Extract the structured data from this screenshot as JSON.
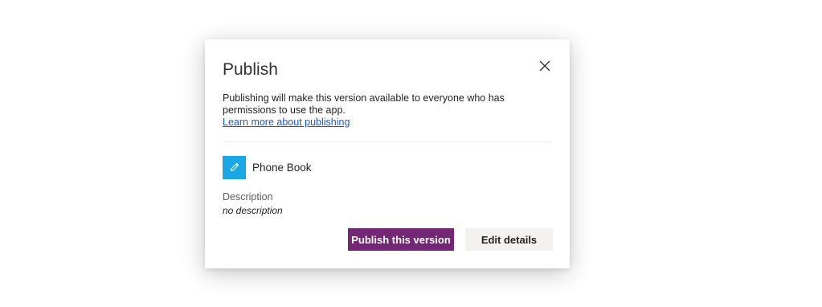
{
  "dialog": {
    "title": "Publish",
    "close_icon": "close-icon",
    "message": "Publishing will make this version available to everyone who has permissions to use the app.",
    "learn_more_link": "Learn more about publishing",
    "app": {
      "icon": "pencil-icon",
      "icon_color": "#1aa7e6",
      "name": "Phone Book"
    },
    "description_label": "Description",
    "description_value": "no description",
    "primary_button": "Publish this version",
    "primary_button_color": "#742774",
    "secondary_button": "Edit details"
  }
}
